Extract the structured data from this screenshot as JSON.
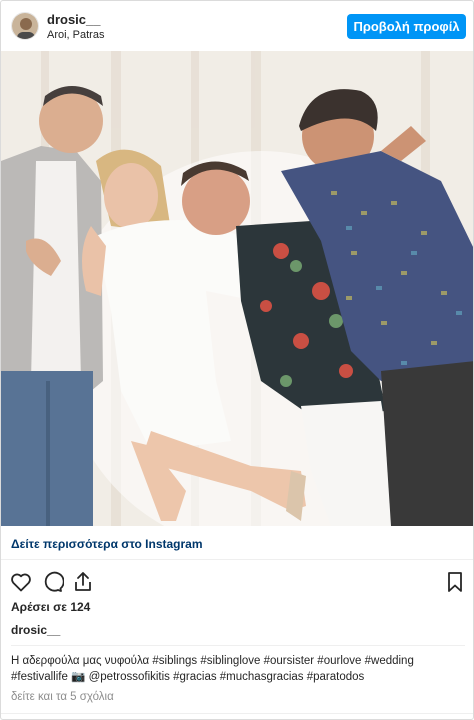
{
  "header": {
    "username": "drosic__",
    "location": "Aroi, Patras",
    "profile_button": "Προβολή προφίλ"
  },
  "post": {
    "see_more": "Δείτε περισσότερα στο Instagram",
    "likes": "Αρέσει σε 124",
    "owner": "drosic__",
    "caption_lines": [
      "Η αδερφούλα μας νυφούλα #siblings #siblinglove #oursister #ourlove #wedding",
      "#festivallife 📷 @petrossofikitis #gracias #muchasgracias #paratodos"
    ],
    "comments_link": "δείτε και τα 5 σχόλια"
  },
  "icons": {
    "like": "heart-icon",
    "comment": "comment-icon",
    "share": "share-icon",
    "save": "bookmark-icon"
  },
  "colors": {
    "primary_button": "#0095f6",
    "link": "#00376b",
    "muted": "#8e8e8e"
  }
}
